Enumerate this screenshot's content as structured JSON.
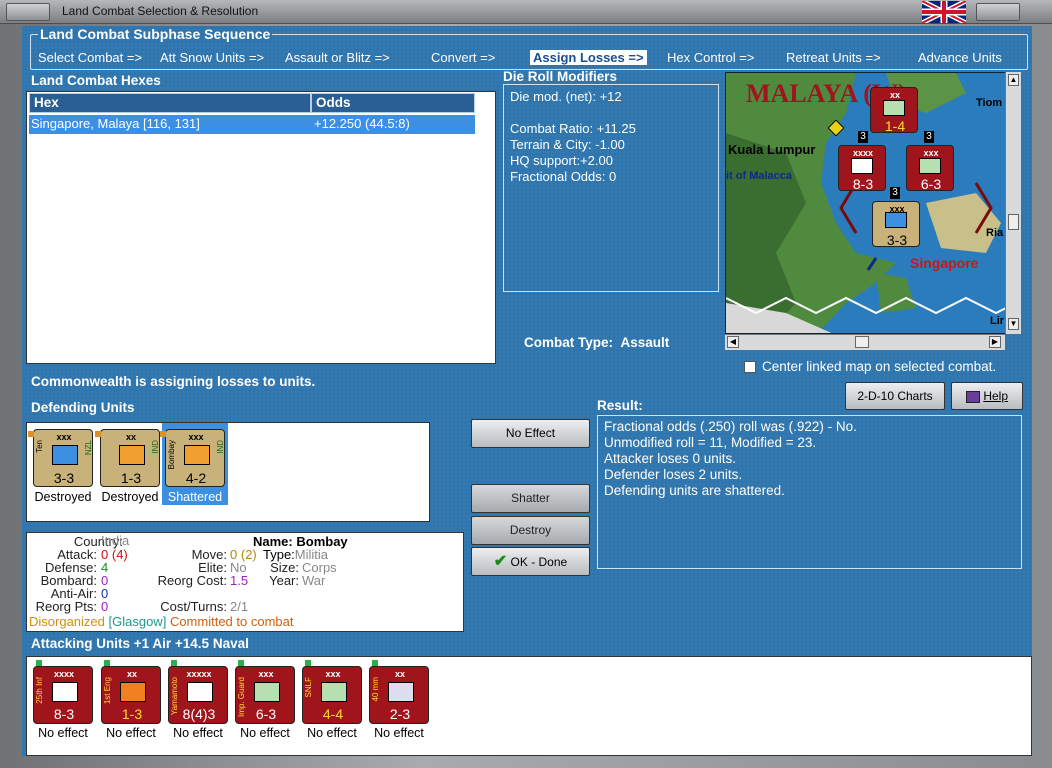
{
  "window": {
    "title": "Land Combat Selection & Resolution"
  },
  "sequence": {
    "title": "Land Combat Subphase Sequence",
    "steps": [
      "Select Combat =>",
      "Att Snow Units =>",
      "Assault or Blitz =>",
      "Convert =>",
      "Assign Losses =>",
      "Hex Control =>",
      "Retreat Units =>",
      "Advance Units"
    ],
    "active_index": 4
  },
  "hexes": {
    "title": "Land Combat Hexes",
    "col_hex": "Hex",
    "col_odds": "Odds",
    "rows": [
      {
        "hex": "Singapore, Malaya [116, 131]",
        "odds": "+12.250 (44.5:8)"
      }
    ]
  },
  "modifiers": {
    "title": "Die Roll Modifiers",
    "lines": [
      "Die mod. (net): +12",
      "",
      "Combat Ratio: +11.25",
      "Terrain & City: -1.00",
      "HQ support:+2.00",
      "Fractional Odds: 0"
    ]
  },
  "map": {
    "labels": {
      "malaya": "MALAYA (W)",
      "kuala": "Kuala Lumpur",
      "strait": "it of Malacca",
      "singapore": "Singapore",
      "tiom": "Tiom",
      "ria": "Ria",
      "lir": "Lir"
    },
    "counters": [
      {
        "str": "1-4",
        "size": "xx",
        "side": "2nd SNLF Nav"
      },
      {
        "str": "8-3",
        "size": "xxxx",
        "side": "25th Inf"
      },
      {
        "str": "6-3",
        "size": "xxx",
        "side": "Imp. Guard"
      },
      {
        "str": "3-3",
        "size": "xxx",
        "side": "Ten"
      }
    ],
    "stack_counts": [
      "3",
      "3",
      "3"
    ],
    "center_checkbox_label": "Center linked map on selected combat."
  },
  "combat_type": {
    "label": "Combat Type:",
    "value": "Assault"
  },
  "status_message": "Commonwealth is assigning losses to units.",
  "buttons": {
    "charts": "2-D-10 Charts",
    "help": "Help",
    "no_effect": "No Effect",
    "shatter": "Shatter",
    "destroy": "Destroy",
    "ok_done": "OK - Done"
  },
  "defending": {
    "title": "Defending Units",
    "units": [
      {
        "size": "xxx",
        "side": "Ten",
        "nat": "NZL",
        "str": "3-3",
        "status": "Destroyed"
      },
      {
        "size": "xx",
        "side": "",
        "nat": "IND",
        "str": "1-3",
        "status": "Destroyed"
      },
      {
        "size": "xxx",
        "side": "Bombay",
        "nat": "IND",
        "str": "4-2",
        "status": "Shattered"
      }
    ]
  },
  "result": {
    "title": "Result:",
    "lines": [
      "Fractional odds (.250) roll was (.922)  - No.",
      "Unmodified roll = 11, Modified = 23.",
      "Attacker loses 0 units.",
      "Defender loses 2 units.",
      "Defending units are shattered."
    ]
  },
  "unit_info": {
    "country_k": "Country:",
    "country_v": "India",
    "attack_k": "Attack:",
    "attack_v": "0",
    "attack_extra": "(4)",
    "defense_k": "Defense:",
    "defense_v": "4",
    "bombard_k": "Bombard:",
    "bombard_v": "0",
    "antiair_k": "Anti-Air:",
    "antiair_v": "0",
    "reorg_k": "Reorg Pts:",
    "reorg_v": "0",
    "name_k": "Name:",
    "name_v": "Bombay",
    "move_k": "Move:",
    "move_v": "0",
    "move_extra": "(2)",
    "type_k": "Type:",
    "type_v": "Militia",
    "elite_k": "Elite:",
    "elite_v": "No",
    "size_k": "Size:",
    "size_v": "Corps",
    "reorgcost_k": "Reorg Cost:",
    "reorgcost_v": "1.5",
    "year_k": "Year:",
    "year_v": "War",
    "costturns_k": "Cost/Turns:",
    "costturns_v": "2/1",
    "status1": "Disorganized",
    "status2": "[Glasgow]",
    "status3": "Committed to combat"
  },
  "attacking": {
    "title": "Attacking Units +1 Air +14.5 Naval",
    "units": [
      {
        "size": "xxxx",
        "side": "25th Inf",
        "str": "8-3",
        "status": "No effect"
      },
      {
        "size": "xx",
        "side": "1st Eng",
        "str": "1-3",
        "status": "No effect"
      },
      {
        "size": "xxxxx",
        "side": "Yamamoto",
        "str": "8(4)3",
        "status": "No effect"
      },
      {
        "size": "xxx",
        "side": "Imp. Guard",
        "str": "6-3",
        "status": "No effect"
      },
      {
        "size": "xxx",
        "side": "SNLF",
        "str": "4-4",
        "status": "No effect"
      },
      {
        "size": "xx",
        "side": "40 mm",
        "str": "2-3",
        "status": "No effect"
      }
    ]
  },
  "colors": {
    "panel": "#2f75ae",
    "japan": "#a0141b",
    "commonwealth": "#c9b27a",
    "selected": "#3d8fe2"
  }
}
